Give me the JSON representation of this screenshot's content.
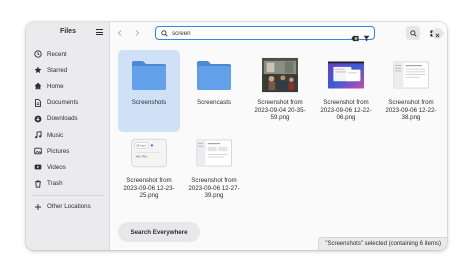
{
  "sidebar": {
    "title": "Files",
    "items": [
      {
        "label": "Recent",
        "icon": "clock-icon"
      },
      {
        "label": "Starred",
        "icon": "star-icon"
      },
      {
        "label": "Home",
        "icon": "home-icon"
      },
      {
        "label": "Documents",
        "icon": "document-icon"
      },
      {
        "label": "Downloads",
        "icon": "download-icon"
      },
      {
        "label": "Music",
        "icon": "music-icon"
      },
      {
        "label": "Pictures",
        "icon": "picture-icon"
      },
      {
        "label": "Videos",
        "icon": "video-icon"
      },
      {
        "label": "Trash",
        "icon": "trash-icon"
      }
    ],
    "other_locations": "Other Locations"
  },
  "toolbar": {
    "search_value": "screen"
  },
  "files": [
    {
      "name": "Screenshots",
      "type": "folder",
      "selected": true
    },
    {
      "name": "Screencasts",
      "type": "folder",
      "selected": false
    },
    {
      "name": "Screenshot from 2023-09-04 20-35-59.png",
      "type": "photo",
      "selected": false
    },
    {
      "name": "Screenshot from 2023-09-06 12-22-06.png",
      "type": "desktop",
      "selected": false
    },
    {
      "name": "Screenshot from 2023-09-06 12-22-38.png",
      "type": "doc",
      "selected": false
    },
    {
      "name": "Screenshot from 2023-09-06 12-23-25.png",
      "type": "dialog",
      "selected": false
    },
    {
      "name": "Screenshot from 2023-09-06 12-27-39.png",
      "type": "doc2",
      "selected": false
    }
  ],
  "search_everywhere": "Search Everywhere",
  "status": "\"Screenshots\" selected (containing 6 items)",
  "colors": {
    "accent": "#3584e4",
    "folder": "#62a0ea",
    "selection": "#cfe1f7"
  }
}
